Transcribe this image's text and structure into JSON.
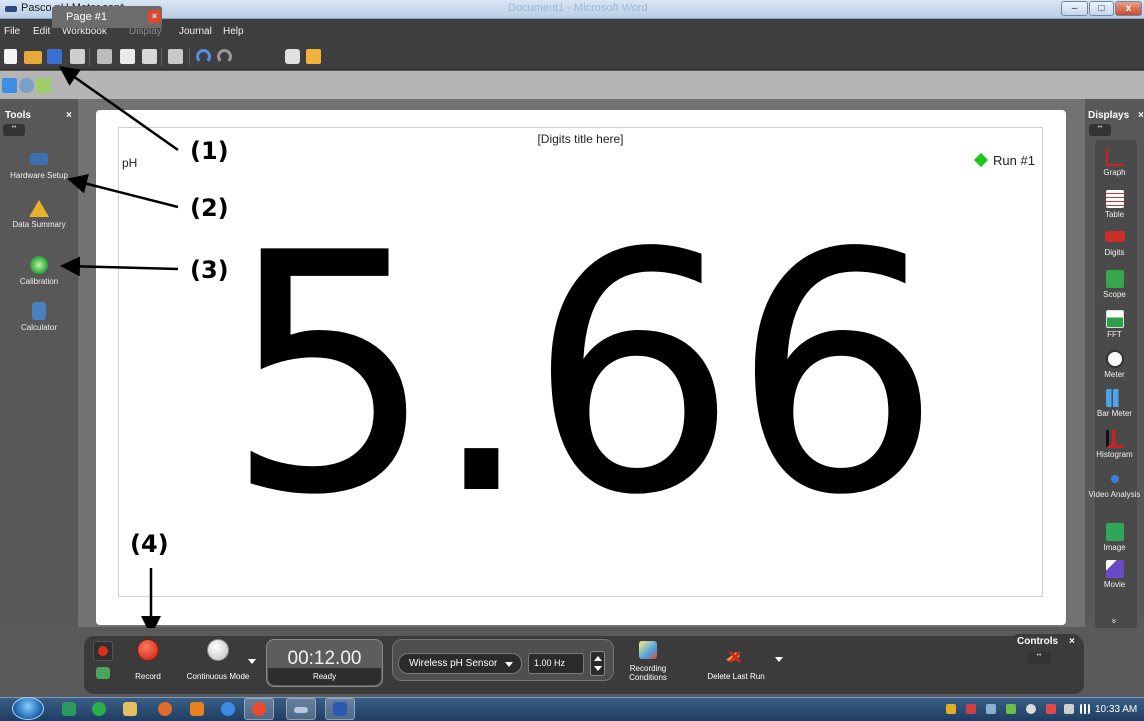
{
  "window": {
    "title": "Pasco pH Meter.cap*",
    "background_doc_title": "Document1 - Microsoft Word",
    "controls": {
      "minimize": "–",
      "maximize": "□",
      "close": "x"
    }
  },
  "menu": [
    {
      "label": "File",
      "enabled": true
    },
    {
      "label": "Edit",
      "enabled": true
    },
    {
      "label": "Workbook",
      "enabled": true
    },
    {
      "label": "Display",
      "enabled": false
    },
    {
      "label": "Journal",
      "enabled": true
    },
    {
      "label": "Help",
      "enabled": true
    }
  ],
  "toolbar": {
    "icons": [
      "new-file-icon",
      "open-folder-icon",
      "save-icon",
      "print-icon",
      "cut-icon",
      "copy-icon",
      "paste-icon",
      "delete-icon",
      "undo-icon",
      "redo-icon",
      "camera-icon",
      "journal-icon"
    ]
  },
  "page_tab": {
    "label": "Page #1",
    "close": "×"
  },
  "tools_panel": {
    "title": "Tools",
    "close": "×",
    "dots": "••",
    "items": [
      {
        "label": "Hardware Setup",
        "icon": "hardware-icon"
      },
      {
        "label": "Data Summary",
        "icon": "data-summary-icon"
      },
      {
        "label": "Calibration",
        "icon": "calibration-icon"
      },
      {
        "label": "Calculator",
        "icon": "calculator-icon"
      }
    ]
  },
  "displays_panel": {
    "title": "Displays",
    "close": "×",
    "dots": "••",
    "more": "»",
    "items": [
      {
        "label": "Graph",
        "icon": "graph-icon"
      },
      {
        "label": "Table",
        "icon": "table-icon"
      },
      {
        "label": "Digits",
        "icon": "digits-icon"
      },
      {
        "label": "Scope",
        "icon": "scope-icon"
      },
      {
        "label": "FFT",
        "icon": "fft-icon"
      },
      {
        "label": "Meter",
        "icon": "meter-icon"
      },
      {
        "label": "Bar Meter",
        "icon": "bar-meter-icon"
      },
      {
        "label": "Histogram",
        "icon": "histogram-icon"
      },
      {
        "label": "Video Analysis",
        "icon": "video-analysis-icon"
      },
      {
        "label": "Image",
        "icon": "image-icon"
      },
      {
        "label": "Movie",
        "icon": "movie-icon"
      }
    ]
  },
  "display": {
    "title": "[Digits title here]",
    "measurement": "pH",
    "run_label": "Run #1",
    "run_color": "#1ec51e",
    "value": "5.66"
  },
  "annotations": [
    "(1)",
    "(2)",
    "(3)",
    "(4)"
  ],
  "controls": {
    "record_label": "Record",
    "mode_label": "Continuous Mode",
    "timer": "00:12.00",
    "status": "Ready",
    "sensor": "Wireless pH Sensor",
    "rate": "1.00 Hz",
    "recording_conditions": "Recording Conditions",
    "delete_last_run": "Delete Last Run",
    "panel_title": "Controls",
    "panel_close": "×",
    "panel_dots": "••"
  },
  "taskbar": {
    "clock": "10:33 AM"
  }
}
